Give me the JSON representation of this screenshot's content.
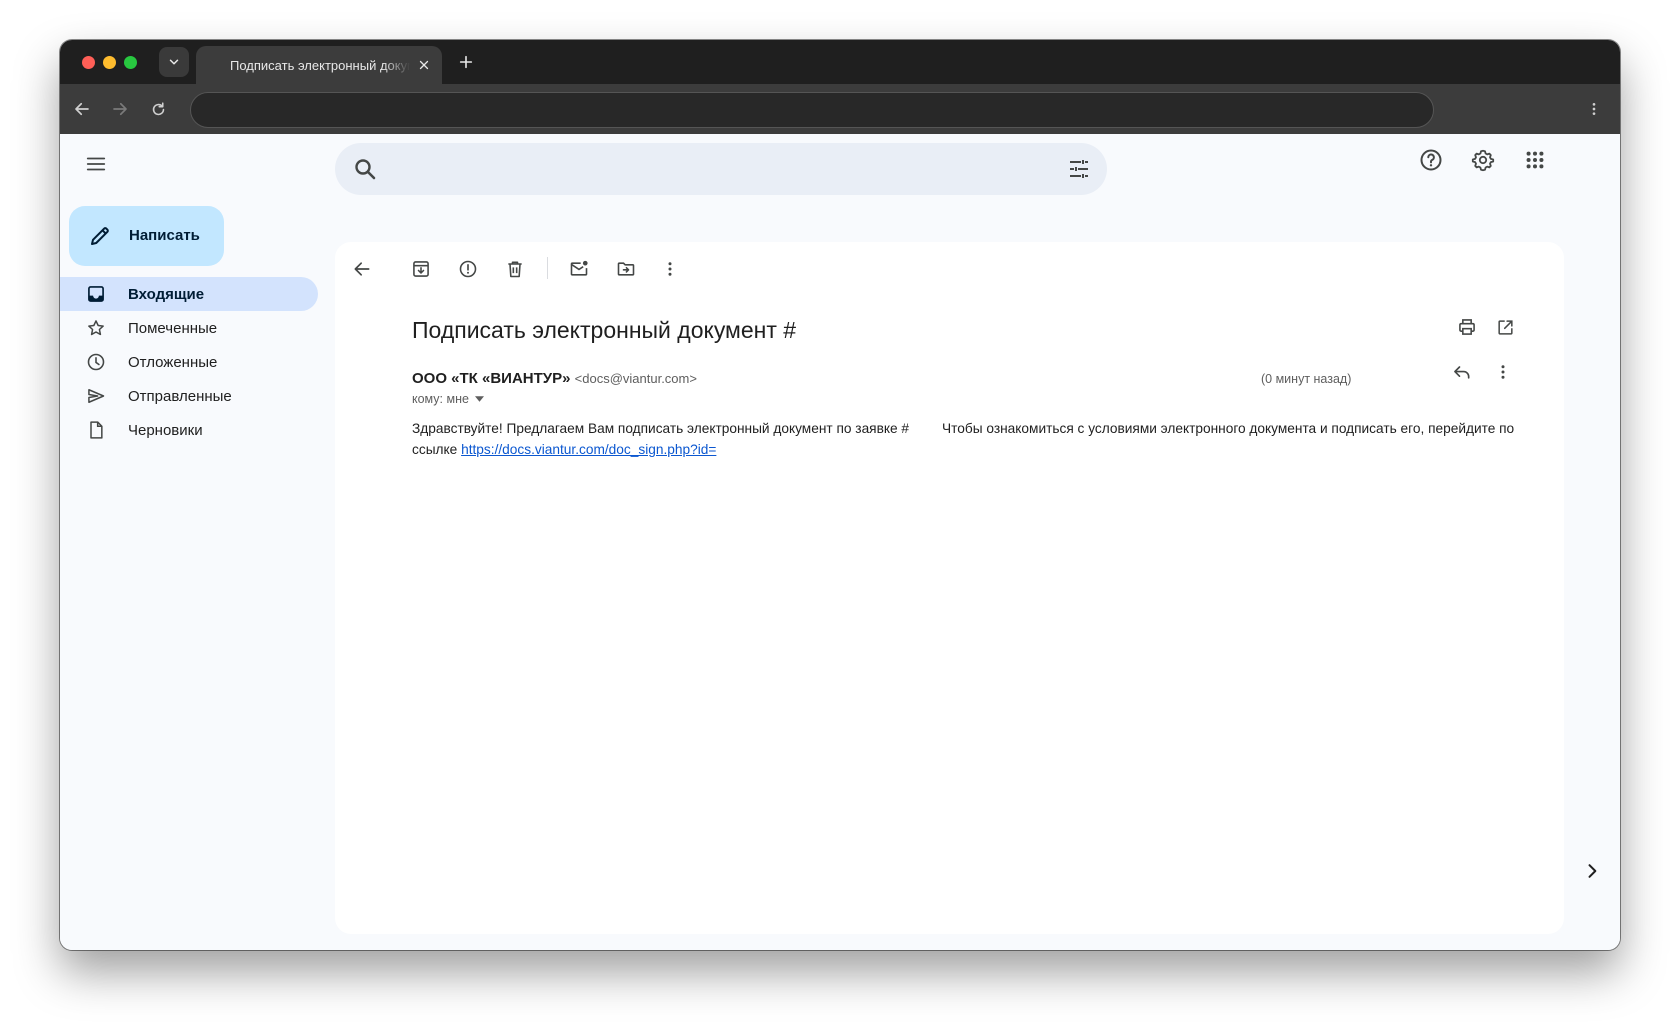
{
  "browser": {
    "tab_title": "Подписать электронный документ #",
    "address": ""
  },
  "gmail": {
    "search_placeholder": "",
    "compose_label": "Написать",
    "nav": [
      {
        "label": "Входящие",
        "icon": "inbox-icon",
        "active": true
      },
      {
        "label": "Помеченные",
        "icon": "star-icon",
        "active": false
      },
      {
        "label": "Отложенные",
        "icon": "clock-icon",
        "active": false
      },
      {
        "label": "Отправленные",
        "icon": "send-icon",
        "active": false
      },
      {
        "label": "Черновики",
        "icon": "draft-icon",
        "active": false
      }
    ]
  },
  "message": {
    "subject": "Подписать электронный документ #",
    "sender_name": "ООО «ТК «ВИАНТУР»",
    "sender_email": "<docs@viantur.com>",
    "to_label": "кому: мне",
    "time": "(0 минут назад)",
    "body_part1": "Здравствуйте! Предлагаем Вам подписать электронный документ по заявке #",
    "body_part2": "Чтобы ознакомиться с условиями электронного документа и подписать его, перейдите по ссылке",
    "link": "https://docs.viantur.com/doc_sign.php?id="
  }
}
